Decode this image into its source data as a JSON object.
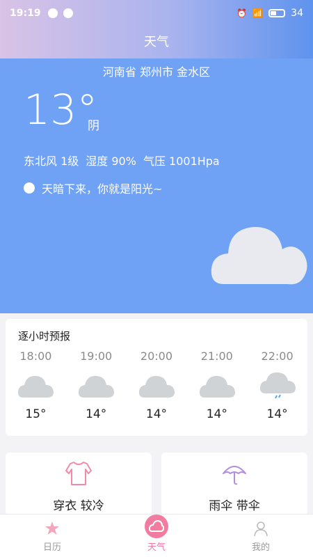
{
  "status_bar": {
    "time": "19:19",
    "battery": "34"
  },
  "header": {
    "title": "天气"
  },
  "current": {
    "location": "河南省 郑州市 金水区",
    "temperature": "13°",
    "condition": "阴",
    "wind": "东北风 1级",
    "humidity": "湿度 90%",
    "pressure": "气压 1001Hpa",
    "motto": "天暗下来，你就是阳光~"
  },
  "hourly": {
    "title": "逐小时预报",
    "items": [
      {
        "time": "18:00",
        "temp": "15°",
        "icon": "cloud-icon"
      },
      {
        "time": "19:00",
        "temp": "14°",
        "icon": "cloud-icon"
      },
      {
        "time": "20:00",
        "temp": "14°",
        "icon": "cloud-icon"
      },
      {
        "time": "21:00",
        "temp": "14°",
        "icon": "cloud-icon"
      },
      {
        "time": "22:00",
        "temp": "14°",
        "icon": "light-rain-icon"
      }
    ]
  },
  "advice": [
    {
      "label": "穿衣 较冷",
      "icon": "sweater-icon"
    },
    {
      "label": "雨伞 带伞",
      "icon": "umbrella-icon"
    }
  ],
  "tabs": [
    {
      "label": "日历",
      "icon": "calendar-star-icon"
    },
    {
      "label": "天气",
      "icon": "weather-icon"
    },
    {
      "label": "我的",
      "icon": "profile-icon"
    }
  ],
  "colors": {
    "sky": "#6fa1f5",
    "accent": "#f17ca0"
  }
}
